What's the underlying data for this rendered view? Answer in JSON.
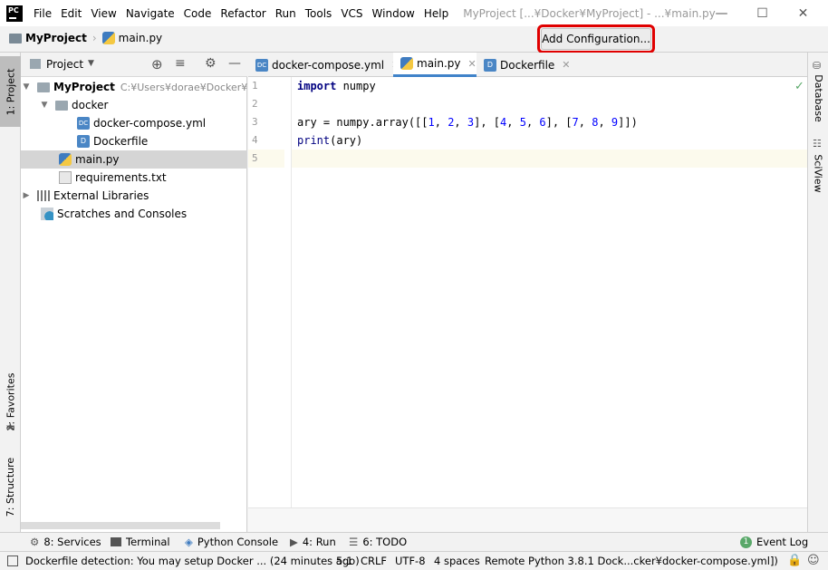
{
  "titlebar": {
    "logo_text": "PC",
    "menus": [
      "File",
      "Edit",
      "View",
      "Navigate",
      "Code",
      "Refactor",
      "Run",
      "Tools",
      "VCS",
      "Window",
      "Help"
    ],
    "window_title": "MyProject [...¥Docker¥MyProject] - ...¥main.py",
    "minimize_icon": "minimize-icon",
    "maximize_icon": "maximize-icon",
    "close_icon": "close-icon"
  },
  "navbar": {
    "project": "MyProject",
    "file": "main.py",
    "add_configuration": "Add Configuration..."
  },
  "left_tabs": {
    "project": "1: Project",
    "favorites": "2: Favorites",
    "structure": "7: Structure"
  },
  "right_tabs": {
    "database": "Database",
    "sciview": "SciView"
  },
  "project_panel": {
    "title": "Project",
    "tree": {
      "root_name": "MyProject",
      "root_path": "C:¥Users¥dorae¥Docker¥MyP",
      "docker": "docker",
      "compose": "docker-compose.yml",
      "dockerfile": "Dockerfile",
      "main": "main.py",
      "requirements": "requirements.txt",
      "external": "External Libraries",
      "scratches": "Scratches and Consoles"
    }
  },
  "tabs": [
    "docker-compose.yml",
    "main.py",
    "Dockerfile"
  ],
  "editor": {
    "line_numbers": [
      "1",
      "2",
      "3",
      "4",
      "5"
    ],
    "line1": {
      "kw": "import",
      "rest": " numpy"
    },
    "line3": {
      "a": "ary = numpy.array([[",
      "n1": "1",
      "s1": ", ",
      "n2": "2",
      "s2": ", ",
      "n3": "3",
      "s3": "], [",
      "n4": "4",
      "s4": ", ",
      "n5": "5",
      "s5": ", ",
      "n6": "6",
      "s6": "], [",
      "n7": "7",
      "s7": ", ",
      "n8": "8",
      "s8": ", ",
      "n9": "9",
      "s9": "]])"
    },
    "line4": {
      "fn": "print",
      "rest": "(ary)"
    }
  },
  "bottom_tabs": {
    "services": "8: Services",
    "terminal": "Terminal",
    "python_console": "Python Console",
    "run": "4: Run",
    "todo": "6: TODO",
    "event_log": "Event Log",
    "event_count": "1"
  },
  "status": {
    "message": "Dockerfile detection: You may setup Docker ... (24 minutes ago)",
    "position": "5:1",
    "line_sep": "CRLF",
    "encoding": "UTF-8",
    "indent": "4 spaces",
    "interpreter": "Remote Python 3.8.1 Dock...cker¥docker-compose.yml])"
  },
  "colors": {
    "highlight": "#e00000",
    "keyword": "#000080",
    "number": "#0000ff",
    "selection": "#d5d5d5",
    "ok_check": "#59a869"
  }
}
